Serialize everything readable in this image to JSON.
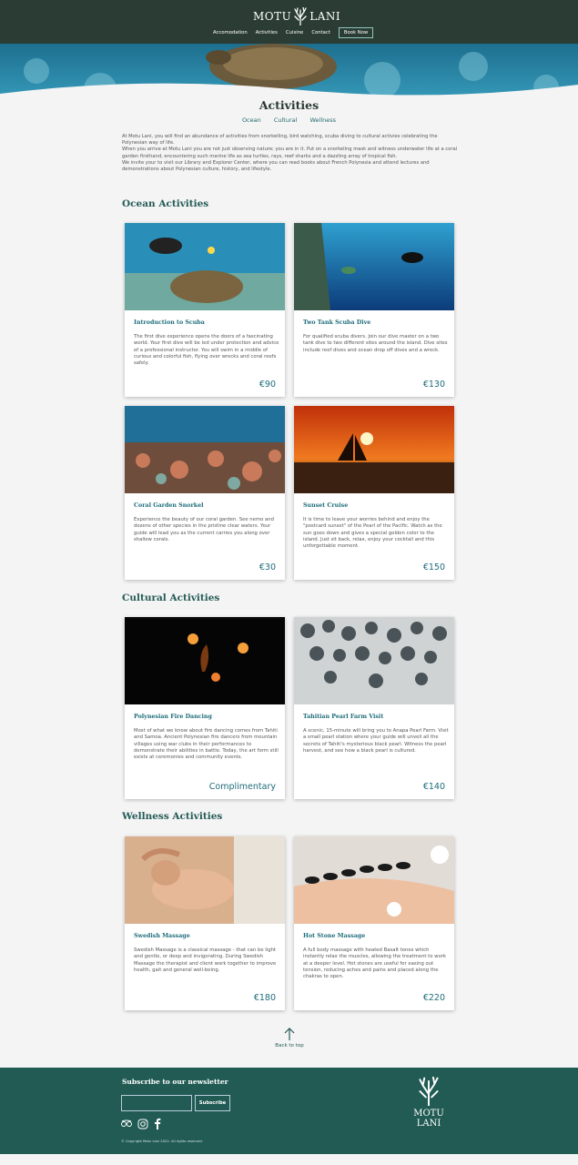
{
  "header": {
    "logo_text_left": "MOTU",
    "logo_text_right": "LANI",
    "nav": [
      "Accomodation",
      "Activities",
      "Cuisine",
      "Contact"
    ],
    "book_button": "Book Now"
  },
  "page": {
    "title": "Activities",
    "subnav": [
      "Ocean",
      "Cultural",
      "Wellness"
    ],
    "intro": [
      "At Motu Lani, you will find an abundance of activities from snorkelling, bird watching, scuba diving to cultural activies celebrating the Polynesian way of life.",
      "When you arrive at Motu Lani you are not just observing nature; you are in it. Put on a snorkeling mask and witness underwater life at a coral garden firsthand, encountering such marine life as sea turtles, rays, reef sharks and a dazzling array of tropical fish.",
      "We invite your to visit our Library and Explorer Center, where you can read books about French Polynesia and attend lectures and demonstrations about Polynesian culture, history, and lifestyle."
    ]
  },
  "sections": {
    "ocean": {
      "title": "Ocean Activities",
      "cards": [
        {
          "title": "Introduction to Scuba",
          "desc": "The first dive experience opens the doors of a fascinating world. Your first dive will be led under protection and advice of a professional instructor. You will swim in a middle of curious and colorful fish, flying over wrecks and coral reefs safely.",
          "price": "€90"
        },
        {
          "title": "Two Tank Scuba Dive",
          "desc": "For qualified scuba divers. Join our dive master on a two tank dive to two different sites around the island. Dive sites include reef dives and ocean drop off dives and a wreck.",
          "price": "€130"
        },
        {
          "title": "Coral Garden Snorkel",
          "desc": "Experience the beauty of our coral garden. See nemo and dozens of other species in the pristine clear waters. Your guide will lead you as the current carries you along over shallow corals.",
          "price": "€30"
        },
        {
          "title": "Sunset Cruise",
          "desc": "It is time to leave your worries behind and enjoy the \"postcard sunset\" of the Pearl of the Pacific. Watch as the sun goes down and gives a special golden color to the island. Just sit back, relax, enjoy your cocktail and this unforgettable moment.",
          "price": "€150"
        }
      ]
    },
    "cultural": {
      "title": "Cultural Activities",
      "cards": [
        {
          "title": "Polynesian Fire Dancing",
          "desc": "Most of what we know about fire dancing comes from Tahiti and Samoa. Ancient Polynesian fire dancers from mountain villages using war clubs in their performances to demonstrate their abilities in battle. Today, the art form still exists at ceremonies and community events.",
          "price": "Complimentary"
        },
        {
          "title": "Tahitian Pearl Farm Visit",
          "desc": "A scenic, 15-minute will bring you to Anapa Pearl Farm. Visit a small pearl station where your guide will unveil all the secrets of Tahiti's mysterious black pearl. Witness the pearl harvest, and see how a black pearl is cultured.",
          "price": "€140"
        }
      ]
    },
    "wellness": {
      "title": "Wellness Activities",
      "cards": [
        {
          "title": "Swedish Massage",
          "desc": "Swedish Massage is a classical massage - that can be light and gentle, or deep and invigorating. During Swedish Massage the therapist and client work together to improve health, gait and general well-being.",
          "price": "€180"
        },
        {
          "title": "Hot Stone Massage",
          "desc": "A full body massage with heated Basalt tones which instantly relax the muscles, allowing the treatment to work at a deeper level. Hot stones are useful for easing out tension, reducing aches and pains and placed along the chakras to open.",
          "price": "€220"
        }
      ]
    }
  },
  "back_to_top": "Back to top",
  "footer": {
    "newsletter_title": "Subscribe to our newsletter",
    "email_placeholder": "",
    "subscribe_button": "Subscribe",
    "copyright": "© Copyright Motu Lani 2022. All rights reserved.",
    "logo_text": "MOTU LANI"
  },
  "colors": {
    "header": "#2b3c35",
    "accent": "#1d6c7a",
    "footer": "#215b54"
  }
}
